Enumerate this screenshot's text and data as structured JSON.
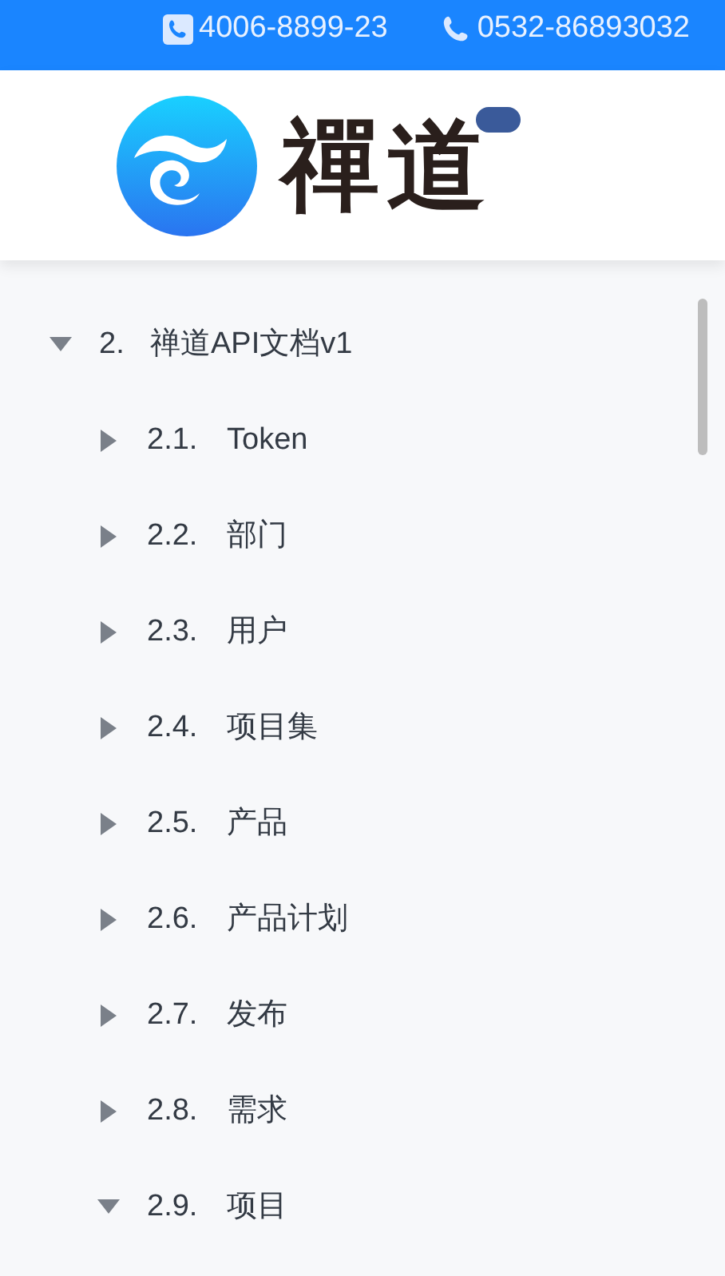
{
  "header": {
    "phones": [
      {
        "kind": "square",
        "number": "4006-8899-23"
      },
      {
        "kind": "plain",
        "number": "0532-86893032"
      }
    ]
  },
  "logo": {
    "text": "禪道"
  },
  "tree": [
    {
      "number": "2.",
      "label": "禅道API文档v1",
      "expanded": true,
      "children": [
        {
          "number": "2.1.",
          "label": "Token",
          "expanded": false
        },
        {
          "number": "2.2.",
          "label": "部门",
          "expanded": false
        },
        {
          "number": "2.3.",
          "label": "用户",
          "expanded": false
        },
        {
          "number": "2.4.",
          "label": "项目集",
          "expanded": false
        },
        {
          "number": "2.5.",
          "label": "产品",
          "expanded": false
        },
        {
          "number": "2.6.",
          "label": "产品计划",
          "expanded": false
        },
        {
          "number": "2.7.",
          "label": "发布",
          "expanded": false
        },
        {
          "number": "2.8.",
          "label": "需求",
          "expanded": false
        },
        {
          "number": "2.9.",
          "label": "项目",
          "expanded": true
        }
      ]
    }
  ]
}
